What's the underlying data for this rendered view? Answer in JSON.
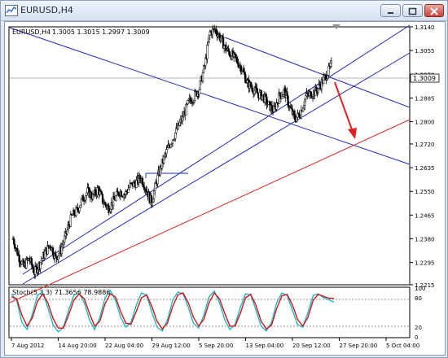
{
  "window": {
    "title": "EURUSD,H4",
    "buttons": [
      "minimize",
      "maximize",
      "close"
    ]
  },
  "chart": {
    "symbol_label": "EURUSD,H4",
    "ohlc_label": "1.3005 1.3015 1.2997 1.3009",
    "current_price_label": "1.3009",
    "stoch_label": "Stoch(5,3,3) 71.3656 78.9886",
    "colors": {
      "candles": "#000000",
      "channel_lines": "#1f2ab8",
      "support_line": "#dd2a2a",
      "arrow": "#e02020",
      "stoch_main": "#20b8c8",
      "stoch_signal": "#d01818"
    }
  },
  "chart_data": [
    {
      "type": "candlestick",
      "title": "EURUSD,H4",
      "ylim": [
        1.2215,
        1.314
      ],
      "y_ticks": [
        "1.3140",
        "1.3055",
        "1.2970",
        "1.2885",
        "1.2800",
        "1.2720",
        "1.2635",
        "1.2550",
        "1.2465",
        "1.2380",
        "1.2295",
        "1.2215"
      ],
      "x_ticks": [
        "7 Aug 2012",
        "14 Aug 20:00",
        "22 Aug 04:00",
        "29 Aug 12:00",
        "5 Sep 20:00",
        "13 Sep 04:00",
        "20 Sep 12:00",
        "27 Sep 20:00",
        "5 Oct 04:00"
      ],
      "close_path": [
        1.238,
        1.232,
        1.228,
        1.231,
        1.226,
        1.229,
        1.233,
        1.236,
        1.231,
        1.234,
        1.24,
        1.246,
        1.248,
        1.252,
        1.255,
        1.253,
        1.256,
        1.251,
        1.249,
        1.252,
        1.255,
        1.254,
        1.257,
        1.258,
        1.26,
        1.256,
        1.251,
        1.259,
        1.265,
        1.27,
        1.274,
        1.278,
        1.282,
        1.287,
        1.289,
        1.292,
        1.3,
        1.312,
        1.313,
        1.31,
        1.306,
        1.304,
        1.302,
        1.299,
        1.294,
        1.292,
        1.29,
        1.289,
        1.286,
        1.284,
        1.289,
        1.291,
        1.285,
        1.281,
        1.283,
        1.289,
        1.29,
        1.291,
        1.294,
        1.297,
        1.3009
      ]
    },
    {
      "type": "line",
      "title": "Stoch(5,3,3)",
      "ylim": [
        0,
        100
      ],
      "levels": [
        20,
        80
      ],
      "y_ticks": [
        "100",
        "80",
        "20",
        "0"
      ],
      "series": [
        {
          "name": "main",
          "values": [
            88,
            75,
            30,
            15,
            45,
            85,
            92,
            60,
            25,
            10,
            20,
            55,
            85,
            90,
            70,
            35,
            15,
            40,
            80,
            95,
            75,
            40,
            20,
            30,
            65,
            90,
            85,
            50,
            20,
            12,
            35,
            75,
            92,
            88,
            60,
            28,
            18,
            45,
            82,
            94,
            70,
            35,
            15,
            25,
            60,
            88,
            86,
            55,
            22,
            12,
            30,
            70,
            90,
            85,
            55,
            25,
            20,
            50,
            85,
            88,
            80,
            76,
            71
          ]
        },
        {
          "name": "signal",
          "values": [
            82,
            78,
            45,
            22,
            38,
            72,
            88,
            70,
            38,
            18,
            18,
            45,
            75,
            88,
            78,
            48,
            22,
            32,
            68,
            88,
            82,
            52,
            28,
            26,
            52,
            80,
            86,
            62,
            32,
            16,
            28,
            62,
            86,
            90,
            70,
            40,
            22,
            36,
            70,
            90,
            78,
            48,
            22,
            22,
            48,
            80,
            87,
            65,
            32,
            16,
            24,
            58,
            84,
            87,
            66,
            36,
            22,
            40,
            75,
            87,
            83,
            79,
            79
          ]
        }
      ]
    }
  ]
}
